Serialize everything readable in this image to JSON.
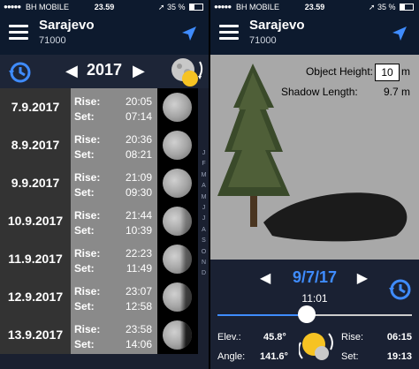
{
  "status": {
    "carrier": "BH MOBILE",
    "time": "23.59",
    "battery": "35 %"
  },
  "location": {
    "city": "Sarajevo",
    "zip": "71000"
  },
  "calendar": {
    "year": "2017",
    "rise_label": "Rise:",
    "set_label": "Set:",
    "rows": [
      {
        "date": "7.9.2017",
        "rise": "20:05",
        "set": "07:14"
      },
      {
        "date": "8.9.2017",
        "rise": "20:36",
        "set": "08:21"
      },
      {
        "date": "9.9.2017",
        "rise": "21:09",
        "set": "09:30"
      },
      {
        "date": "10.9.2017",
        "rise": "21:44",
        "set": "10:39"
      },
      {
        "date": "11.9.2017",
        "rise": "22:23",
        "set": "11:49"
      },
      {
        "date": "12.9.2017",
        "rise": "23:07",
        "set": "12:58"
      },
      {
        "date": "13.9.2017",
        "rise": "23:58",
        "set": "14:06"
      }
    ],
    "months": [
      "J",
      "F",
      "M",
      "A",
      "M",
      "J",
      "J",
      "A",
      "S",
      "O",
      "N",
      "D"
    ]
  },
  "shadow": {
    "object_height_label": "Object Height:",
    "object_height_value": "10",
    "object_height_unit": "m",
    "shadow_length_label": "Shadow Length:",
    "shadow_length_value": "9.7 m",
    "date": "9/7/17",
    "time": "11:01",
    "slider_fraction": 0.46,
    "elev_label": "Elev.:",
    "elev_value": "45.8°",
    "angle_label": "Angle:",
    "angle_value": "141.6°",
    "rise_label": "Rise:",
    "rise_value": "06:15",
    "set_label": "Set:",
    "set_value": "19:13"
  },
  "colors": {
    "accent": "#3f8cff",
    "header": "#0d1a2e"
  }
}
